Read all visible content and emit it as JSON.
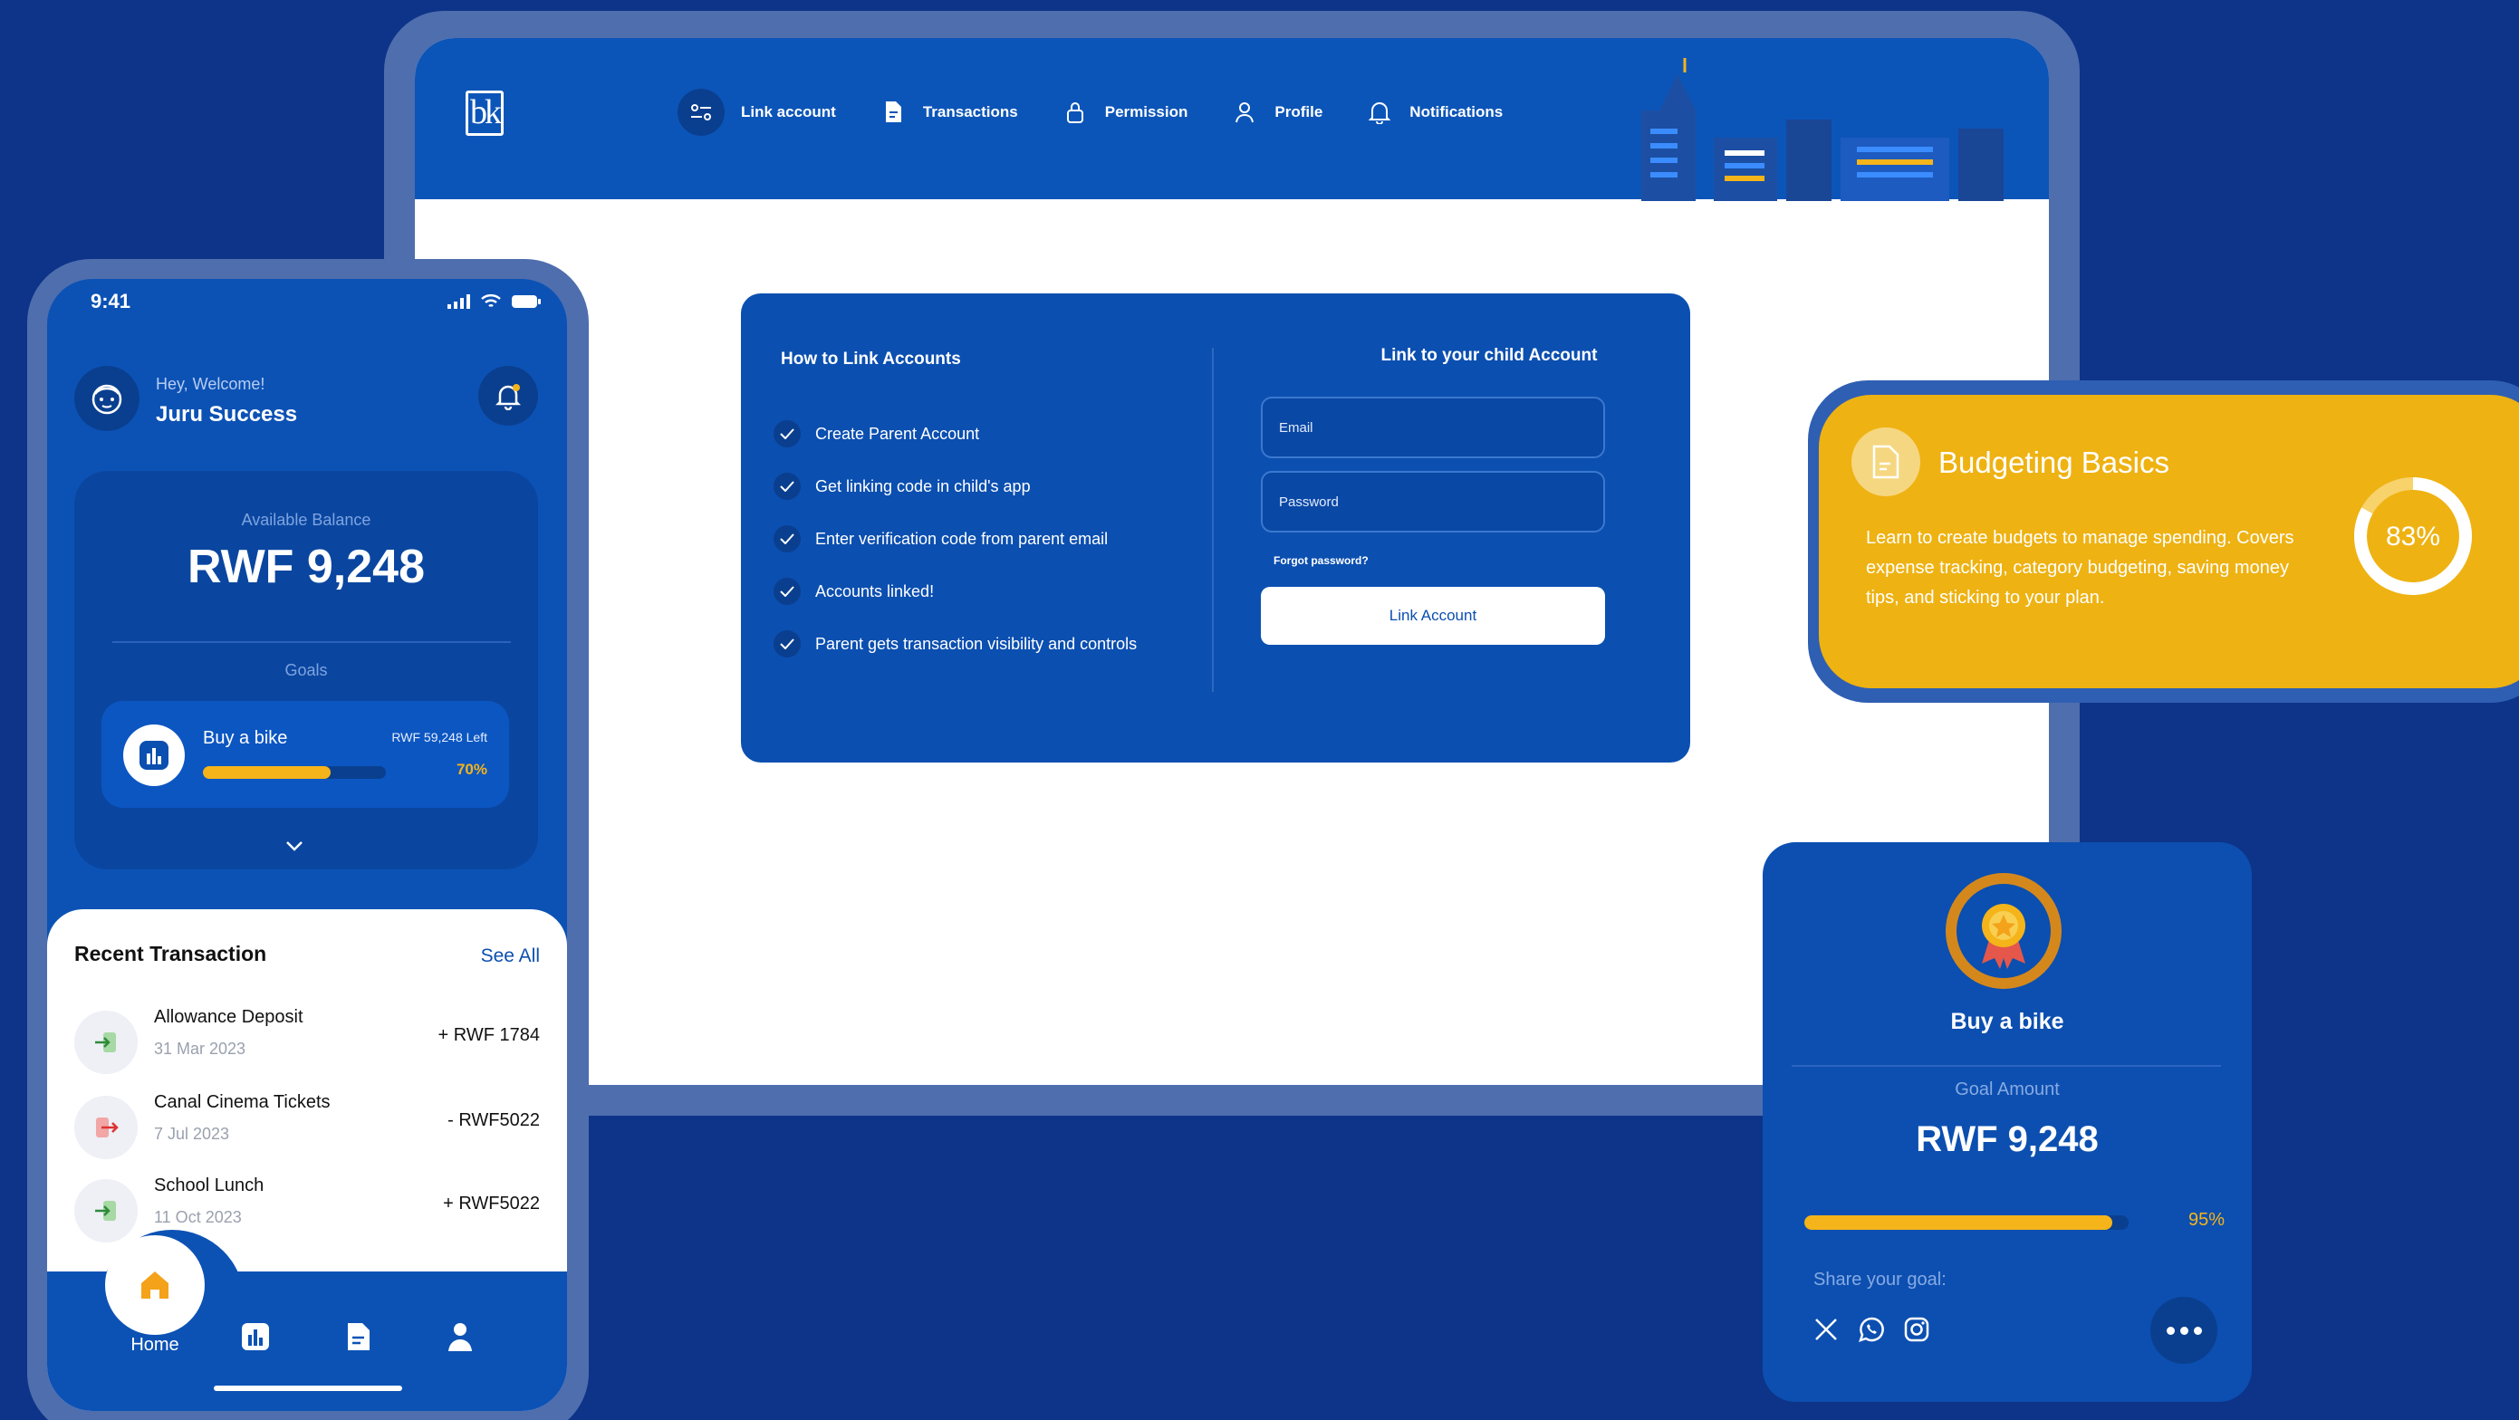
{
  "brand": {
    "logo_text": "bk"
  },
  "desktop": {
    "nav": [
      {
        "label": "Link account",
        "icon": "sliders-icon"
      },
      {
        "label": "Transactions",
        "icon": "document-icon"
      },
      {
        "label": "Permission",
        "icon": "lock-icon"
      },
      {
        "label": "Profile",
        "icon": "user-icon"
      },
      {
        "label": "Notifications",
        "icon": "bell-icon"
      }
    ],
    "how_to": {
      "title": "How to Link Accounts",
      "steps": [
        "Create Parent Account",
        "Get linking code in child's app",
        "Enter verification code from parent email",
        "Accounts linked!",
        "Parent gets transaction visibility and controls"
      ]
    },
    "form": {
      "title": "Link to your child Account",
      "email_placeholder": "Email",
      "password_placeholder": "Password",
      "forgot": "Forgot password?",
      "button": "Link Account"
    }
  },
  "phone": {
    "time": "9:41",
    "greeting": "Hey, Welcome!",
    "name": "Juru Success",
    "balance_label": "Available Balance",
    "balance": "RWF 9,248",
    "goals_label": "Goals",
    "goal": {
      "name": "Buy a bike",
      "left": "RWF 59,248 Left",
      "percent_label": "70%",
      "progress": 0.7
    },
    "recent_title": "Recent Transaction",
    "see_all": "See All",
    "transactions": [
      {
        "name": "Allowance Deposit",
        "date": "31 Mar 2023",
        "amount": "+ RWF 1784",
        "type": "in"
      },
      {
        "name": "Canal Cinema Tickets",
        "date": "7 Jul 2023",
        "amount": "- RWF5022",
        "type": "out"
      },
      {
        "name": "School Lunch",
        "date": "11 Oct 2023",
        "amount": "+ RWF5022",
        "type": "in"
      }
    ],
    "tabs": {
      "home": "Home"
    }
  },
  "budget": {
    "title": "Budgeting Basics",
    "description": "Learn to create budgets to manage spending. Covers expense tracking, category budgeting, saving money tips, and sticking to your plan.",
    "percent_label": "83%",
    "progress": 0.83
  },
  "goal_card": {
    "title": "Buy a bike",
    "amount_label": "Goal Amount",
    "amount": "RWF 9,248",
    "percent_label": "95%",
    "progress": 0.95,
    "share_label": "Share your goal:",
    "social": [
      "x-icon",
      "whatsapp-icon",
      "instagram-icon"
    ]
  },
  "colors": {
    "background": "#0d3488",
    "primary": "#0c52b5",
    "accent": "#f4b41a",
    "budget": "#eeb212"
  }
}
